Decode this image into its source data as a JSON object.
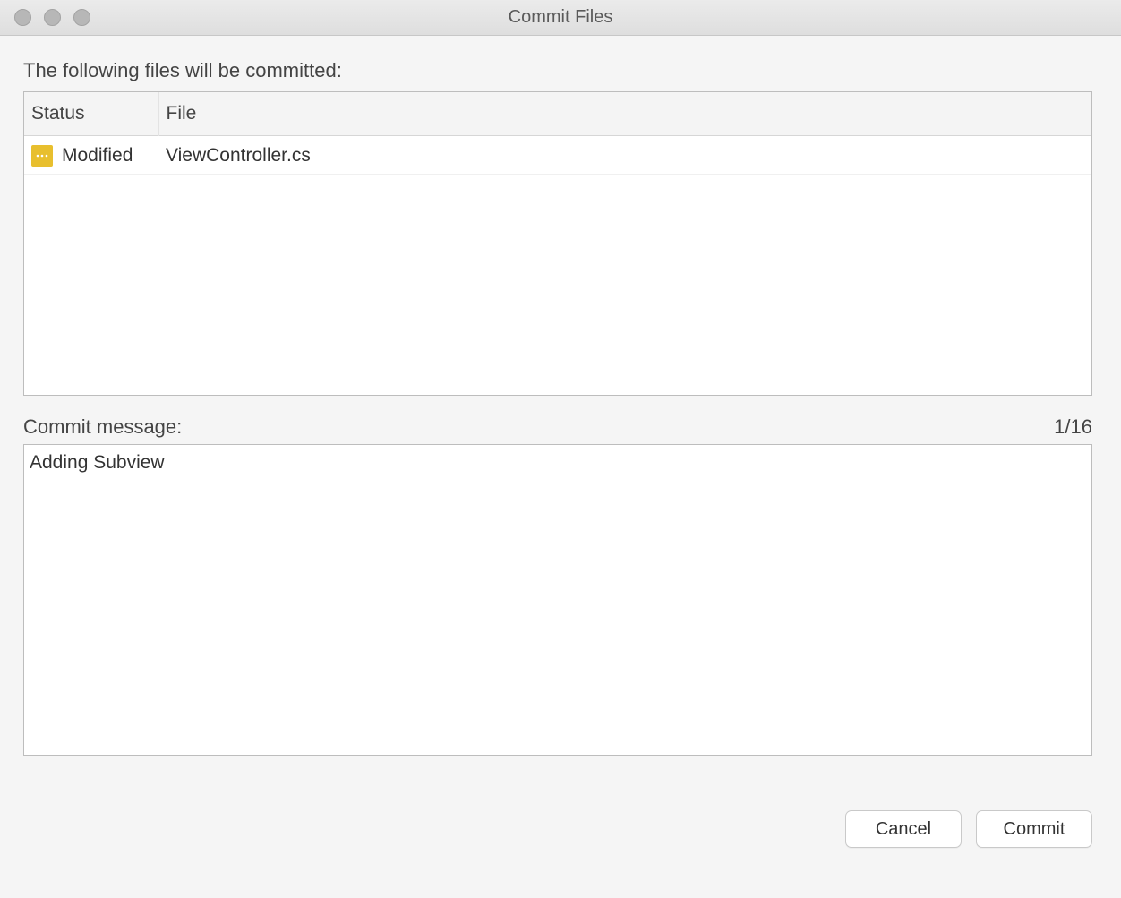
{
  "window": {
    "title": "Commit Files"
  },
  "header_label": "The following files will be committed:",
  "table": {
    "columns": {
      "status": "Status",
      "file": "File"
    },
    "rows": [
      {
        "status": "Modified",
        "file": "ViewController.cs",
        "icon": "modified-icon"
      }
    ]
  },
  "commit": {
    "label": "Commit message:",
    "counter": "1/16",
    "value": "Adding Subview"
  },
  "buttons": {
    "cancel": "Cancel",
    "commit": "Commit"
  }
}
